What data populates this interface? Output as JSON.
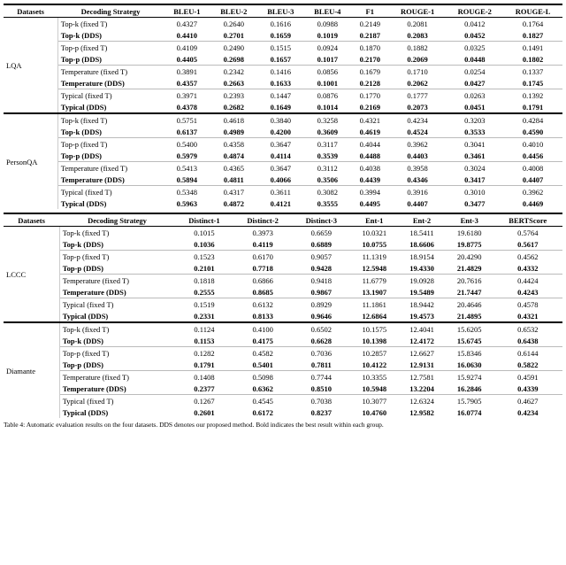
{
  "table1": {
    "headers": [
      "Datasets",
      "Decoding Strategy",
      "BLEU-1",
      "BLEU-2",
      "BLEU-3",
      "BLEU-4",
      "F1",
      "ROUGE-1",
      "ROUGE-2",
      "ROUGE-L"
    ],
    "sections": [
      {
        "dataset": "LQA",
        "rowspan": 8,
        "groups": [
          {
            "rows": [
              {
                "strategy": "Top-k (fixed T)",
                "bold": false,
                "values": [
                  "0.4327",
                  "0.2640",
                  "0.1616",
                  "0.0988",
                  "0.2149",
                  "0.2081",
                  "0.0412",
                  "0.1764"
                ]
              },
              {
                "strategy": "Top-k (DDS)",
                "bold": true,
                "values": [
                  "0.4410",
                  "0.2701",
                  "0.1659",
                  "0.1019",
                  "0.2187",
                  "0.2083",
                  "0.0452",
                  "0.1827"
                ]
              }
            ]
          },
          {
            "rows": [
              {
                "strategy": "Top-p (fixed T)",
                "bold": false,
                "values": [
                  "0.4109",
                  "0.2490",
                  "0.1515",
                  "0.0924",
                  "0.1870",
                  "0.1882",
                  "0.0325",
                  "0.1491"
                ]
              },
              {
                "strategy": "Top-p (DDS)",
                "bold": true,
                "values": [
                  "0.4405",
                  "0.2698",
                  "0.1657",
                  "0.1017",
                  "0.2170",
                  "0.2069",
                  "0.0448",
                  "0.1802"
                ]
              }
            ]
          },
          {
            "rows": [
              {
                "strategy": "Temperature (fixed T)",
                "bold": false,
                "values": [
                  "0.3891",
                  "0.2342",
                  "0.1416",
                  "0.0856",
                  "0.1679",
                  "0.1710",
                  "0.0254",
                  "0.1337"
                ]
              },
              {
                "strategy": "Temperature (DDS)",
                "bold": true,
                "values": [
                  "0.4357",
                  "0.2663",
                  "0.1633",
                  "0.1001",
                  "0.2128",
                  "0.2062",
                  "0.0427",
                  "0.1745"
                ]
              }
            ]
          },
          {
            "rows": [
              {
                "strategy": "Typical (fixed T)",
                "bold": false,
                "values": [
                  "0.3971",
                  "0.2393",
                  "0.1447",
                  "0.0876",
                  "0.1770",
                  "0.1777",
                  "0.0263",
                  "0.1392"
                ]
              },
              {
                "strategy": "Typical (DDS)",
                "bold": true,
                "values": [
                  "0.4378",
                  "0.2682",
                  "0.1649",
                  "0.1014",
                  "0.2169",
                  "0.2073",
                  "0.0451",
                  "0.1791"
                ]
              }
            ]
          }
        ]
      },
      {
        "dataset": "PersonQA",
        "rowspan": 8,
        "groups": [
          {
            "rows": [
              {
                "strategy": "Top-k (fixed T)",
                "bold": false,
                "values": [
                  "0.5751",
                  "0.4618",
                  "0.3840",
                  "0.3258",
                  "0.4321",
                  "0.4234",
                  "0.3203",
                  "0.4284"
                ]
              },
              {
                "strategy": "Top-k (DDS)",
                "bold": true,
                "values": [
                  "0.6137",
                  "0.4989",
                  "0.4200",
                  "0.3609",
                  "0.4619",
                  "0.4524",
                  "0.3533",
                  "0.4590"
                ]
              }
            ]
          },
          {
            "rows": [
              {
                "strategy": "Top-p (fixed T)",
                "bold": false,
                "values": [
                  "0.5400",
                  "0.4358",
                  "0.3647",
                  "0.3117",
                  "0.4044",
                  "0.3962",
                  "0.3041",
                  "0.4010"
                ]
              },
              {
                "strategy": "Top-p (DDS)",
                "bold": true,
                "values": [
                  "0.5979",
                  "0.4874",
                  "0.4114",
                  "0.3539",
                  "0.4488",
                  "0.4403",
                  "0.3461",
                  "0.4456"
                ]
              }
            ]
          },
          {
            "rows": [
              {
                "strategy": "Temperature (fixed T)",
                "bold": false,
                "values": [
                  "0.5413",
                  "0.4365",
                  "0.3647",
                  "0.3112",
                  "0.4038",
                  "0.3958",
                  "0.3024",
                  "0.4008"
                ]
              },
              {
                "strategy": "Temperature (DDS)",
                "bold": true,
                "values": [
                  "0.5894",
                  "0.4811",
                  "0.4066",
                  "0.3506",
                  "0.4439",
                  "0.4346",
                  "0.3417",
                  "0.4407"
                ]
              }
            ]
          },
          {
            "rows": [
              {
                "strategy": "Typical (fixed T)",
                "bold": false,
                "values": [
                  "0.5348",
                  "0.4317",
                  "0.3611",
                  "0.3082",
                  "0.3994",
                  "0.3916",
                  "0.3010",
                  "0.3962"
                ]
              },
              {
                "strategy": "Typical (DDS)",
                "bold": true,
                "values": [
                  "0.5963",
                  "0.4872",
                  "0.4121",
                  "0.3555",
                  "0.4495",
                  "0.4407",
                  "0.3477",
                  "0.4469"
                ]
              }
            ]
          }
        ]
      }
    ]
  },
  "table2": {
    "headers": [
      "Datasets",
      "Decoding Strategy",
      "Distinct-1",
      "Distinct-2",
      "Distinct-3",
      "Ent-1",
      "Ent-2",
      "Ent-3",
      "BERTScore"
    ],
    "sections": [
      {
        "dataset": "LCCC",
        "rowspan": 8,
        "groups": [
          {
            "rows": [
              {
                "strategy": "Top-k (fixed T)",
                "bold": false,
                "values": [
                  "0.1015",
                  "0.3973",
                  "0.6659",
                  "10.0321",
                  "18.5411",
                  "19.6180",
                  "0.5764"
                ]
              },
              {
                "strategy": "Top-k (DDS)",
                "bold": true,
                "values": [
                  "0.1036",
                  "0.4119",
                  "0.6889",
                  "10.0755",
                  "18.6606",
                  "19.8775",
                  "0.5617"
                ]
              }
            ]
          },
          {
            "rows": [
              {
                "strategy": "Top-p (fixed T)",
                "bold": false,
                "values": [
                  "0.1523",
                  "0.6170",
                  "0.9057",
                  "11.1319",
                  "18.9154",
                  "20.4290",
                  "0.4562"
                ]
              },
              {
                "strategy": "Top-p (DDS)",
                "bold": true,
                "values": [
                  "0.2101",
                  "0.7718",
                  "0.9428",
                  "12.5948",
                  "19.4330",
                  "21.4829",
                  "0.4332"
                ]
              }
            ]
          },
          {
            "rows": [
              {
                "strategy": "Temperature (fixed T)",
                "bold": false,
                "values": [
                  "0.1818",
                  "0.6866",
                  "0.9418",
                  "11.6779",
                  "19.0928",
                  "20.7616",
                  "0.4424"
                ]
              },
              {
                "strategy": "Temperature (DDS)",
                "bold": true,
                "values": [
                  "0.2555",
                  "0.8685",
                  "0.9867",
                  "13.1907",
                  "19.5489",
                  "21.7447",
                  "0.4243"
                ]
              }
            ]
          },
          {
            "rows": [
              {
                "strategy": "Typical (fixed T)",
                "bold": false,
                "values": [
                  "0.1519",
                  "0.6132",
                  "0.8929",
                  "11.1861",
                  "18.9442",
                  "20.4646",
                  "0.4578"
                ]
              },
              {
                "strategy": "Typical (DDS)",
                "bold": true,
                "values": [
                  "0.2331",
                  "0.8133",
                  "0.9646",
                  "12.6864",
                  "19.4573",
                  "21.4895",
                  "0.4321"
                ]
              }
            ]
          }
        ]
      },
      {
        "dataset": "Diamante",
        "rowspan": 8,
        "groups": [
          {
            "rows": [
              {
                "strategy": "Top-k (fixed T)",
                "bold": false,
                "values": [
                  "0.1124",
                  "0.4100",
                  "0.6502",
                  "10.1575",
                  "12.4041",
                  "15.6205",
                  "0.6532"
                ]
              },
              {
                "strategy": "Top-k (DDS)",
                "bold": true,
                "values": [
                  "0.1153",
                  "0.4175",
                  "0.6628",
                  "10.1398",
                  "12.4172",
                  "15.6745",
                  "0.6438"
                ]
              }
            ]
          },
          {
            "rows": [
              {
                "strategy": "Top-p (fixed T)",
                "bold": false,
                "values": [
                  "0.1282",
                  "0.4582",
                  "0.7036",
                  "10.2857",
                  "12.6627",
                  "15.8346",
                  "0.6144"
                ]
              },
              {
                "strategy": "Top-p (DDS)",
                "bold": true,
                "values": [
                  "0.1791",
                  "0.5401",
                  "0.7811",
                  "10.4122",
                  "12.9131",
                  "16.0630",
                  "0.5822"
                ]
              }
            ]
          },
          {
            "rows": [
              {
                "strategy": "Temperature (fixed T)",
                "bold": false,
                "values": [
                  "0.1408",
                  "0.5098",
                  "0.7744",
                  "10.3355",
                  "12.7581",
                  "15.9274",
                  "0.4591"
                ]
              },
              {
                "strategy": "Temperature (DDS)",
                "bold": true,
                "values": [
                  "0.2377",
                  "0.6362",
                  "0.8510",
                  "10.5948",
                  "13.2204",
                  "16.2846",
                  "0.4339"
                ]
              }
            ]
          },
          {
            "rows": [
              {
                "strategy": "Typical (fixed T)",
                "bold": false,
                "values": [
                  "0.1267",
                  "0.4545",
                  "0.7038",
                  "10.3077",
                  "12.6324",
                  "15.7905",
                  "0.4627"
                ]
              },
              {
                "strategy": "Typical (DDS)",
                "bold": true,
                "values": [
                  "0.2601",
                  "0.6172",
                  "0.8237",
                  "10.4760",
                  "12.9582",
                  "16.0774",
                  "0.4234"
                ]
              }
            ]
          }
        ]
      }
    ]
  },
  "footer": "Table 4: Automatic evaluation results on the four datasets. DDS denotes our proposed method. Bold indicates the best result within each group."
}
